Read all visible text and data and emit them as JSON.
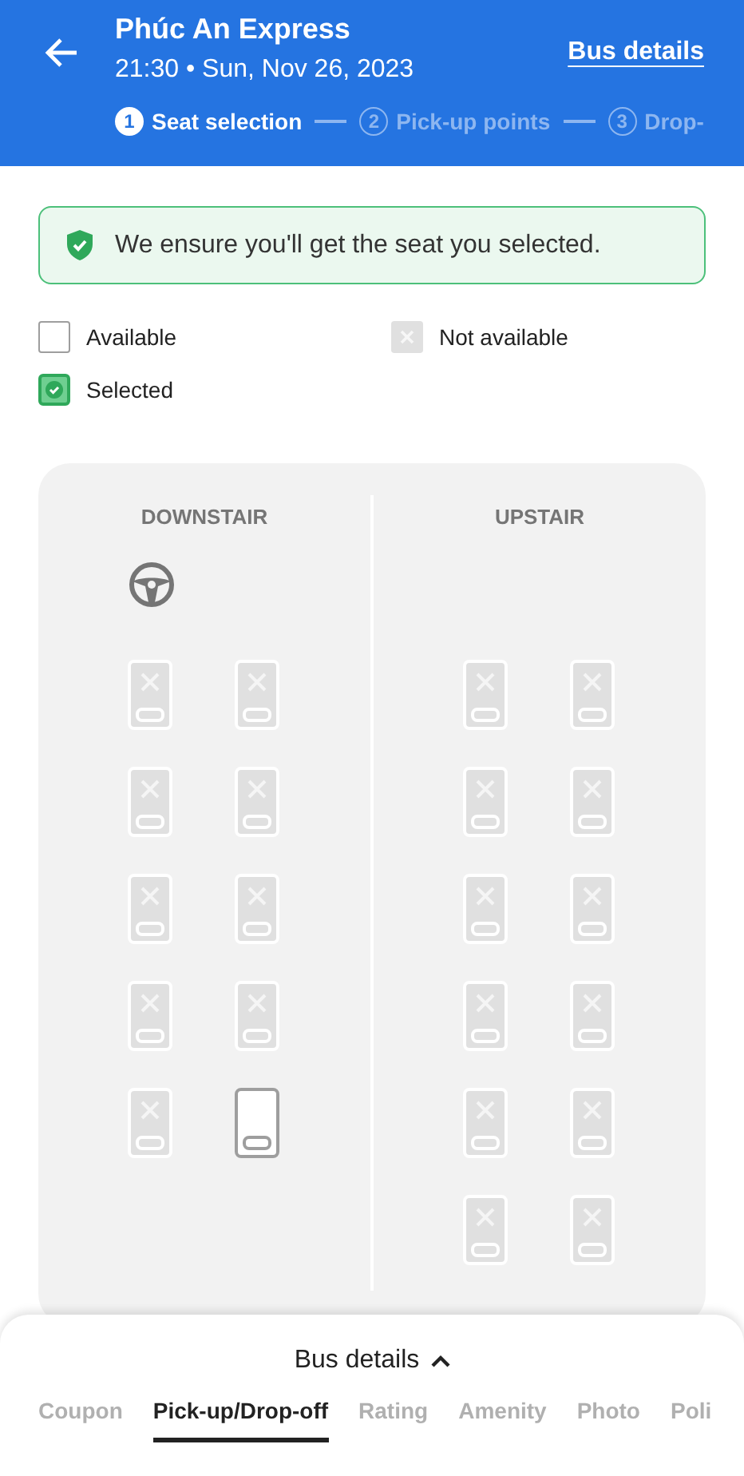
{
  "header": {
    "title": "Phúc An Express",
    "subtitle": "21:30 • Sun, Nov 26, 2023",
    "link": "Bus details"
  },
  "steps": [
    {
      "number": "1",
      "label": "Seat selection",
      "selected": true
    },
    {
      "number": "2",
      "label": "Pick-up points",
      "selected": false
    },
    {
      "number": "3",
      "label": "Drop-",
      "selected": false
    }
  ],
  "notice": "We ensure you'll get the seat you selected.",
  "legend": [
    {
      "kind": "available",
      "label": "Available"
    },
    {
      "kind": "unavailable",
      "label": "Not available"
    },
    {
      "kind": "selected",
      "label": "Selected"
    }
  ],
  "decks": [
    {
      "label": "DOWNSTAIR",
      "driver": true,
      "rows": [
        [
          {
            "available": false,
            "selected": false
          },
          {
            "available": false,
            "selected": false
          }
        ],
        [
          {
            "available": false,
            "selected": false
          },
          {
            "available": false,
            "selected": false
          }
        ],
        [
          {
            "available": false,
            "selected": false
          },
          {
            "available": false,
            "selected": false
          }
        ],
        [
          {
            "available": false,
            "selected": false
          },
          {
            "available": false,
            "selected": false
          }
        ],
        [
          {
            "available": false,
            "selected": false
          },
          {
            "available": true,
            "selected": false
          }
        ]
      ]
    },
    {
      "label": "UPSTAIR",
      "driver": false,
      "rows": [
        [
          {
            "available": false,
            "selected": false
          },
          {
            "available": false,
            "selected": false
          }
        ],
        [
          {
            "available": false,
            "selected": false
          },
          {
            "available": false,
            "selected": false
          }
        ],
        [
          {
            "available": false,
            "selected": false
          },
          {
            "available": false,
            "selected": false
          }
        ],
        [
          {
            "available": false,
            "selected": false
          },
          {
            "available": false,
            "selected": false
          }
        ],
        [
          {
            "available": false,
            "selected": false
          },
          {
            "available": false,
            "selected": false
          }
        ],
        [
          {
            "available": false,
            "selected": false
          },
          {
            "available": false,
            "selected": false
          }
        ]
      ]
    }
  ],
  "sheet": {
    "title": "Bus details",
    "expanded": true,
    "tabs": [
      {
        "label": "Coupon",
        "selected": false
      },
      {
        "label": "Pick-up/Drop-off",
        "selected": true
      },
      {
        "label": "Rating",
        "selected": false
      },
      {
        "label": "Amenity",
        "selected": false
      },
      {
        "label": "Photo",
        "selected": false
      },
      {
        "label": "Poli",
        "selected": false
      }
    ]
  }
}
